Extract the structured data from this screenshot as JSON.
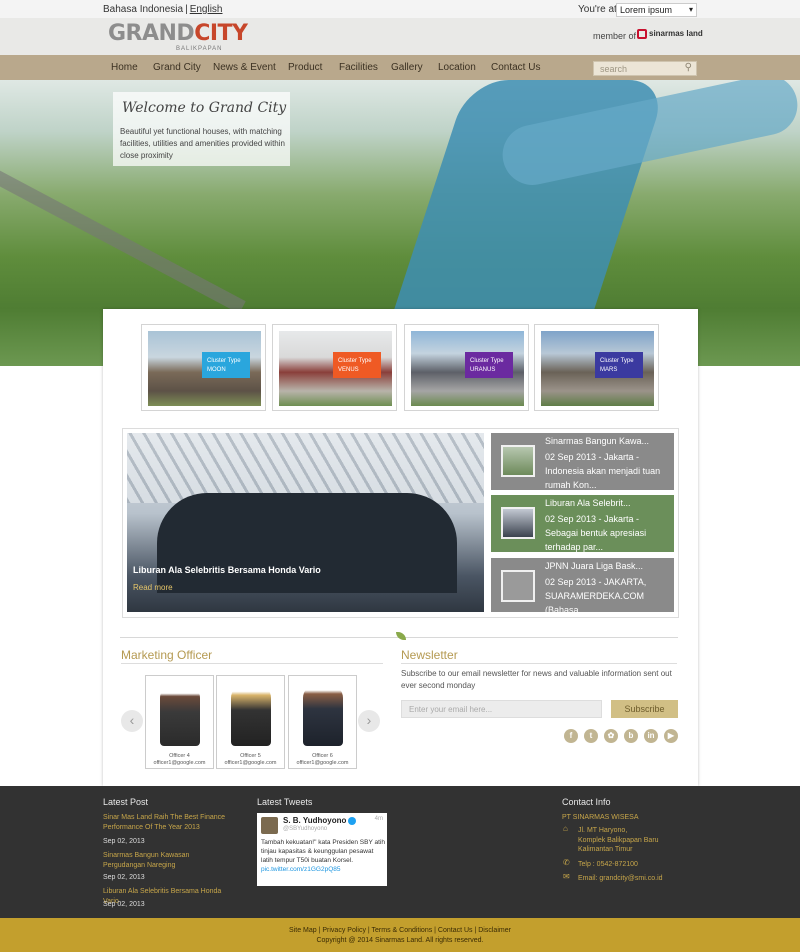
{
  "topbar": {
    "lang_id": "Bahasa Indonesia",
    "lang_sep": "|",
    "lang_en": "English",
    "youre_at": "You're at",
    "location_value": "Lorem ipsum"
  },
  "header": {
    "logo_grand": "GRAND",
    "logo_city": "CITY",
    "logo_sub": "BALIKPAPAN",
    "member_of": "member of",
    "sinarmas": "sinarmas land"
  },
  "nav": {
    "items": [
      "Home",
      "Grand City",
      "News & Event",
      "Product",
      "Facilities",
      "Gallery",
      "Location",
      "Contact Us"
    ],
    "search_placeholder": "search"
  },
  "hero": {
    "welcome_title": "Welcome to Grand City",
    "welcome_text": "Beautiful yet functional houses, with matching facilities, utilities and amenities provided within close proximity"
  },
  "clusters": [
    {
      "line1": "Cluster Type",
      "line2": "MOON",
      "color": "#2aa6dd"
    },
    {
      "line1": "Cluster Type",
      "line2": "VENUS",
      "color": "#ef5a24"
    },
    {
      "line1": "Cluster Type",
      "line2": "URANUS",
      "color": "#6b2aa0"
    },
    {
      "line1": "Cluster Type",
      "line2": "MARS",
      "color": "#3b3aa0"
    }
  ],
  "featured_news": {
    "title": "Liburan Ala Selebritis Bersama Honda Vario",
    "more": "Read more"
  },
  "side_news": [
    {
      "title": "Sinarmas Bangun Kawa...",
      "body": "02 Sep 2013 - Jakarta - Indonesia akan menjadi tuan rumah Kon...",
      "bg": "#8a8a8a"
    },
    {
      "title": "Liburan Ala Selebrit...",
      "body": "02 Sep 2013 - Jakarta - Sebagai bentuk apresiasi terhadap par...",
      "bg": "#6b8f5a"
    },
    {
      "title": "JPNN Juara Liga Bask...",
      "body": "02 Sep 2013 - JAKARTA, SUARAMERDEKA.COM (Bahasa",
      "bg": "#8a8a8a"
    }
  ],
  "marketing": {
    "title": "Marketing Officer",
    "officers": [
      {
        "name": "Officer 4",
        "email": "officer1@google.com"
      },
      {
        "name": "Officer 5",
        "email": "officer1@google.com"
      },
      {
        "name": "Officer 6",
        "email": "officer1@google.com"
      }
    ],
    "prev": "‹",
    "next": "›"
  },
  "newsletter": {
    "title": "Newsletter",
    "text": "Subscribe to our email newsletter for news and valuable information sent out ever second monday",
    "placeholder": "Enter your email here...",
    "button": "Subscribe",
    "social": [
      "f",
      "t",
      "✿",
      "b",
      "in",
      "▶"
    ]
  },
  "footer": {
    "latest_post": "Latest Post",
    "posts": [
      {
        "title": "Sinar Mas Land Raih The Best Finance Performance Of The Year 2013",
        "date": "Sep 02, 2013"
      },
      {
        "title": "Sinarmas Bangun Kawasan Pergudangan Nareging",
        "date": "Sep 02, 2013"
      },
      {
        "title": "Liburan Ala Selebritis Bersama Honda Vario",
        "date": "Sep 02, 2013"
      }
    ],
    "latest_tweets": "Latest Tweets",
    "tweet": {
      "name": "S. B. Yudhoyono",
      "handle": "@SBYudhoyono",
      "time": "4m",
      "text": "Tambah kekuatan!\" kata Presiden SBY atih tinjau kapasitas & keunggulan pesawat latih tempur T50i buatan Korsel.",
      "link": "pic.twitter.com/z1GG2pQ85"
    },
    "contact_info": "Contact Info",
    "contact": {
      "company": "PT SINARMAS WISESA",
      "address1": "Jl. MT Haryono,",
      "address2": "Komplek Balikpapan Baru",
      "address3": "Kalimantan Timur",
      "phone": "Telp : 0542-872100",
      "email": "Email: grandcity@smi.co.id"
    },
    "links": "Site Map | Privacy Policy | Terms & Conditions | Contact Us | Disclaimer",
    "copyright": "Copyright @ 2014 Sinarmas Land. All rights reserved."
  }
}
